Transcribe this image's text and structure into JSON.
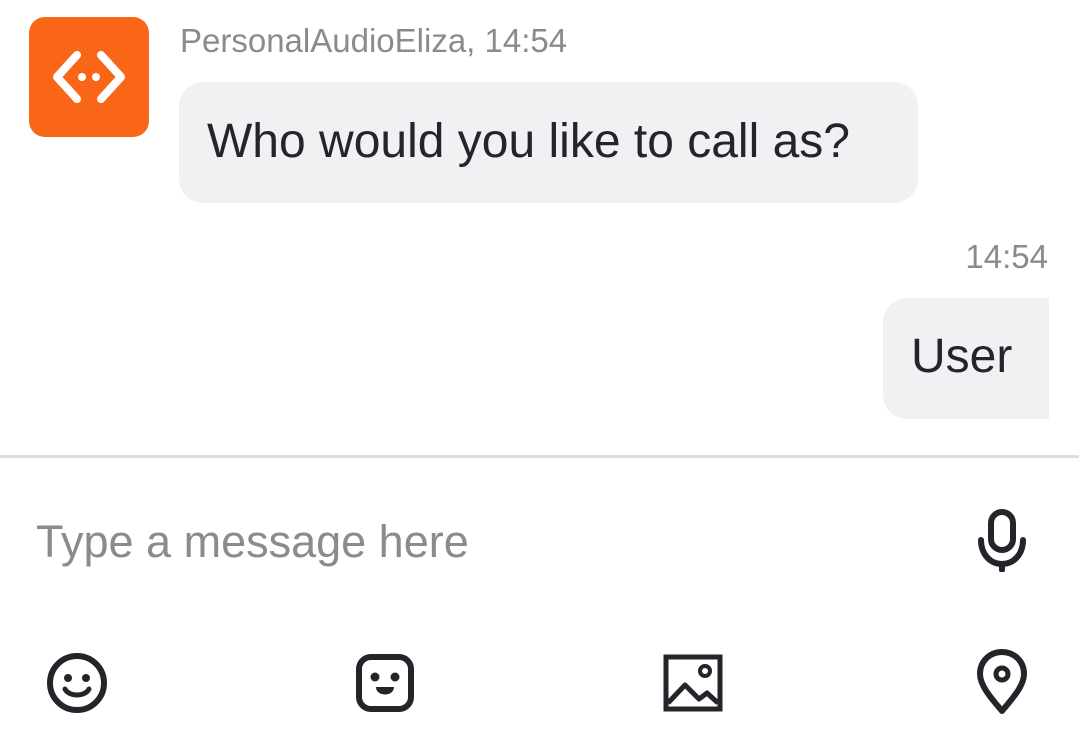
{
  "conversation": {
    "incoming": {
      "sender_meta": "PersonalAudioEliza, 14:54",
      "text": "Who would you like to call as?",
      "avatar_icon": "code-brackets-icon",
      "avatar_color": "#f96617"
    },
    "outgoing": {
      "time": "14:54",
      "text": "User"
    }
  },
  "composer": {
    "placeholder": "Type a message here",
    "value": "",
    "mic_icon": "microphone-icon"
  },
  "toolbar": {
    "icons": [
      "emoji-icon",
      "sticker-icon",
      "image-icon",
      "location-icon"
    ]
  },
  "colors": {
    "accent": "#f96617",
    "bubble_bg": "#f1f1f3",
    "text": "#24242b",
    "muted": "#8a8a8f"
  }
}
